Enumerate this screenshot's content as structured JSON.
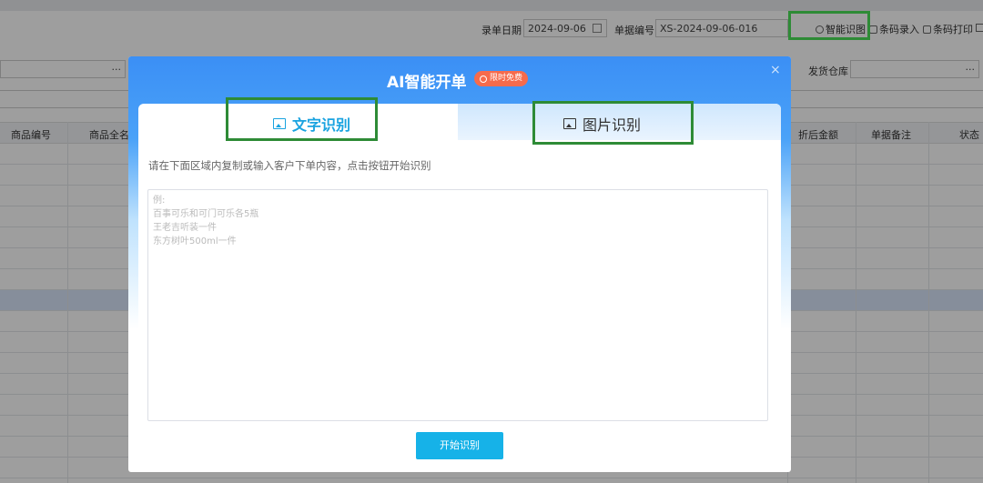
{
  "header": {
    "date_label": "录单日期",
    "date_value": "2024-09-06",
    "doc_no_label": "单据编号",
    "doc_no_value": "XS-2024-09-06-016",
    "warehouse_label": "发货仓库",
    "lookup_dots": "···"
  },
  "toolbar": {
    "smart_recognize": "智能识图",
    "barcode_entry": "条码录入",
    "barcode_print": "条码打印"
  },
  "grid": {
    "columns": [
      "商品编号",
      "商品全名",
      "折后金额",
      "单据备注",
      "状态"
    ]
  },
  "modal": {
    "title": "AI智能开单",
    "badge": "限时免费",
    "close": "×",
    "tabs": [
      {
        "label": "文字识别"
      },
      {
        "label": "图片识别"
      }
    ],
    "hint": "请在下面区域内复制或输入客户下单内容，点击按钮开始识别",
    "textarea_placeholder": "例:\n百事可乐和可门可乐各5瓶\n王老吉听装一件\n东方树叶500ml一件",
    "start_button": "开始识别"
  },
  "colors": {
    "accent": "#16b2e8",
    "active_tab": "#1aa3e0",
    "highlight": "#2e8b36",
    "badge": "#f66b4c"
  }
}
